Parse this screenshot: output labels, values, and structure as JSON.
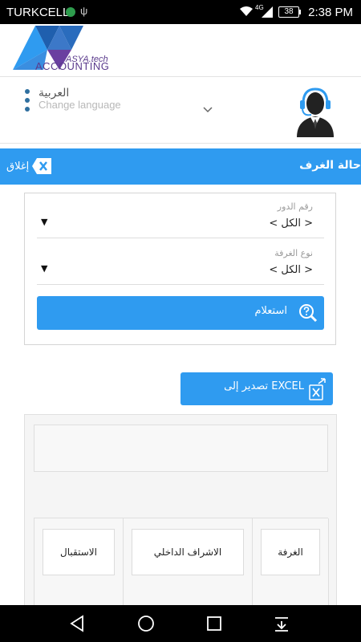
{
  "status_bar": {
    "carrier": "TURKCELL",
    "network": "4G",
    "battery": "38",
    "time": "2:38 PM"
  },
  "header": {
    "logo_sub": "ASYA.tech",
    "logo_main": "ACCOUNTING"
  },
  "language": {
    "native_label": "العربية",
    "english_label": "Change language"
  },
  "title_bar": {
    "close_label": "إغلاق",
    "title": "حالة الغرف"
  },
  "filters": [
    {
      "label": "رقم الدور",
      "value": "< الكل >",
      "arrow": "▼"
    },
    {
      "label": "نوع الغرفة",
      "value": "< الكل >",
      "arrow": "▼"
    }
  ],
  "query_button": {
    "label": "استعلام"
  },
  "export_button": {
    "label": "تصدير إلى EXCEL"
  },
  "table": {
    "columns": [
      "الغرفة",
      "الاشراف الداخلي",
      "الاستقبال"
    ]
  },
  "colors": {
    "primary": "#2f9bf0",
    "status_bar": "#000000",
    "logo_purple": "#5a3a8c"
  },
  "icons": {
    "close": "close-x-icon",
    "query": "search-help-icon",
    "export": "excel-export-icon",
    "agent": "support-agent-icon",
    "nav_back": "back-triangle-icon",
    "nav_home": "home-circle-icon",
    "nav_recent": "recent-square-icon",
    "nav_notifications": "notification-drawer-icon"
  }
}
